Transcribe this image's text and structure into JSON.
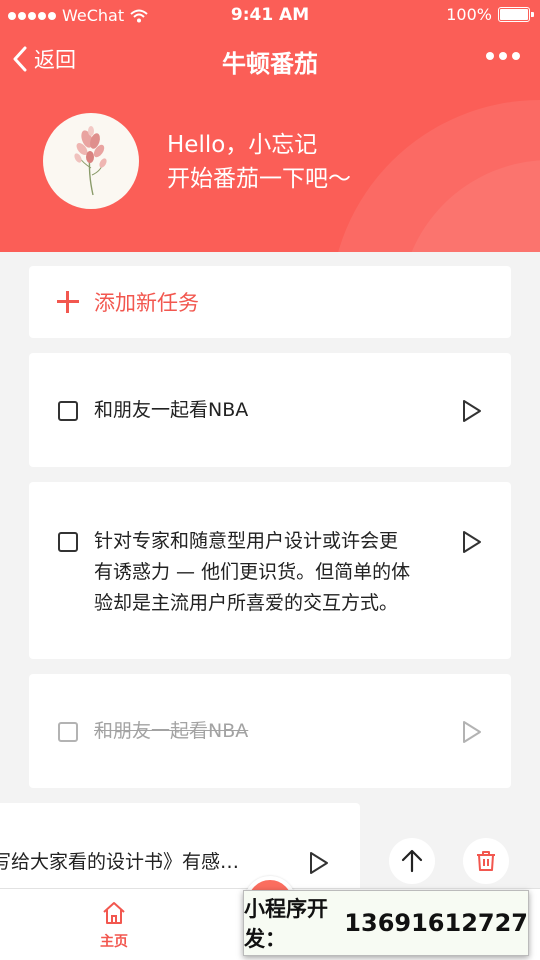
{
  "status_bar": {
    "carrier": "WeChat",
    "time": "9:41 AM",
    "battery": "100%"
  },
  "nav": {
    "back_label": "返回",
    "title": "牛顿番茄"
  },
  "profile": {
    "greeting_line1": "Hello，小忘记",
    "greeting_line2": "开始番茄一下吧～"
  },
  "add_task": {
    "label": "添加新任务"
  },
  "tasks": [
    {
      "text": "和朋友一起看NBA",
      "done": false
    },
    {
      "text_lines": [
        "针对专家和随意型用户设计或许会更",
        "有诱惑力 — 他们更识货。但简单的体",
        "验却是主流用户所喜爱的交互方式。"
      ],
      "done": false
    },
    {
      "text": "和朋友一起看NBA",
      "done": true
    },
    {
      "text": "写给大家看的设计书》有感…",
      "done": false
    }
  ],
  "tabbar": {
    "home_label": "主页"
  },
  "promo": {
    "label": "小程序开发：",
    "phone": "13691612727"
  },
  "colors": {
    "accent": "#fb5e57",
    "accent_text": "#f2574f",
    "background": "#f3f3f3"
  }
}
